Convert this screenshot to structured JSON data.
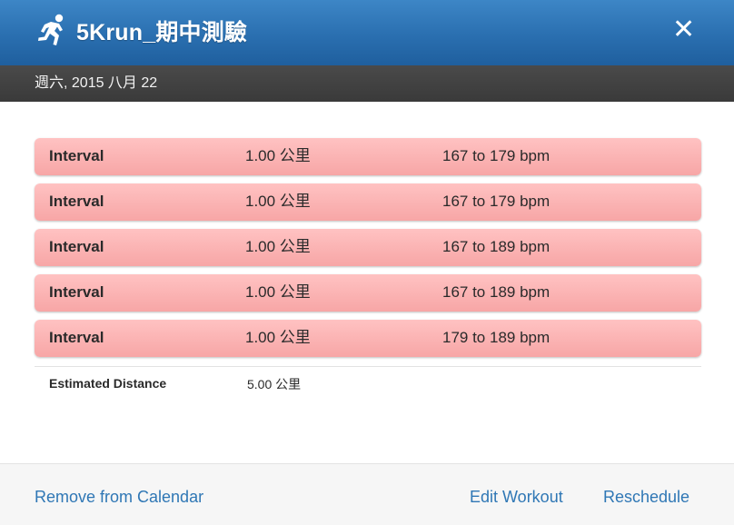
{
  "header": {
    "title": "5Krun_期中測驗",
    "icon": "runner-icon",
    "close_glyph": "✕"
  },
  "date": "週六, 2015 八月 22",
  "steps": [
    {
      "type": "Interval",
      "distance": "1.00 公里",
      "heart_rate": "167 to 179 bpm"
    },
    {
      "type": "Interval",
      "distance": "1.00 公里",
      "heart_rate": "167 to 179 bpm"
    },
    {
      "type": "Interval",
      "distance": "1.00 公里",
      "heart_rate": "167 to 189 bpm"
    },
    {
      "type": "Interval",
      "distance": "1.00 公里",
      "heart_rate": "167 to 189 bpm"
    },
    {
      "type": "Interval",
      "distance": "1.00 公里",
      "heart_rate": "179 to 189 bpm"
    }
  ],
  "estimated": {
    "label": "Estimated Distance",
    "value": "5.00 公里"
  },
  "footer": {
    "remove_label": "Remove from Calendar",
    "edit_label": "Edit Workout",
    "reschedule_label": "Reschedule"
  },
  "colors": {
    "header_blue": "#2a6fb0",
    "date_bar": "#3f3f3f",
    "interval_pink": "#f9b0b0",
    "link_blue": "#2f77b5"
  }
}
